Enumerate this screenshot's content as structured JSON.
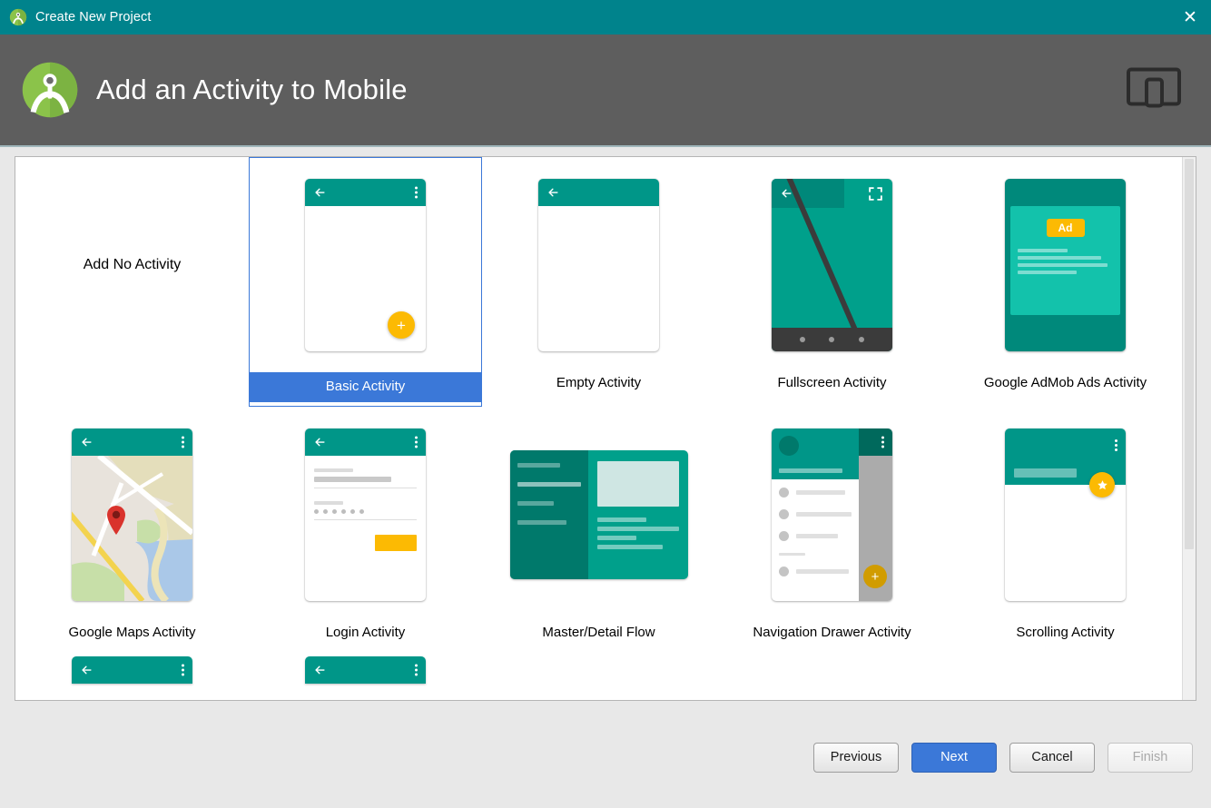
{
  "window": {
    "title": "Create New Project",
    "close_label": "✕",
    "logo_icon": "android-studio-logo-icon",
    "titlebar_color": "#00838c"
  },
  "header": {
    "title": "Add an Activity to Mobile",
    "logo_icon": "android-studio-logo-icon",
    "formfactor_icon": "device-form-factor-icon",
    "background_color": "#5e5e5e"
  },
  "gallery": {
    "selected_index": 1,
    "selection_color": "#3b78d8",
    "accent_teal": "#009688",
    "accent_amber": "#fcba03",
    "items": [
      {
        "label": "Add No Activity",
        "thumb": "none"
      },
      {
        "label": "Basic Activity",
        "thumb": "basic"
      },
      {
        "label": "Empty Activity",
        "thumb": "empty"
      },
      {
        "label": "Fullscreen Activity",
        "thumb": "fullscreen"
      },
      {
        "label": "Google AdMob Ads Activity",
        "thumb": "admob",
        "ad_badge": "Ad"
      },
      {
        "label": "Google Maps Activity",
        "thumb": "maps"
      },
      {
        "label": "Login Activity",
        "thumb": "login"
      },
      {
        "label": "Master/Detail Flow",
        "thumb": "masterdetail"
      },
      {
        "label": "Navigation Drawer Activity",
        "thumb": "navdrawer"
      },
      {
        "label": "Scrolling Activity",
        "thumb": "scrolling"
      }
    ]
  },
  "footer": {
    "previous_label": "Previous",
    "next_label": "Next",
    "cancel_label": "Cancel",
    "finish_label": "Finish"
  }
}
